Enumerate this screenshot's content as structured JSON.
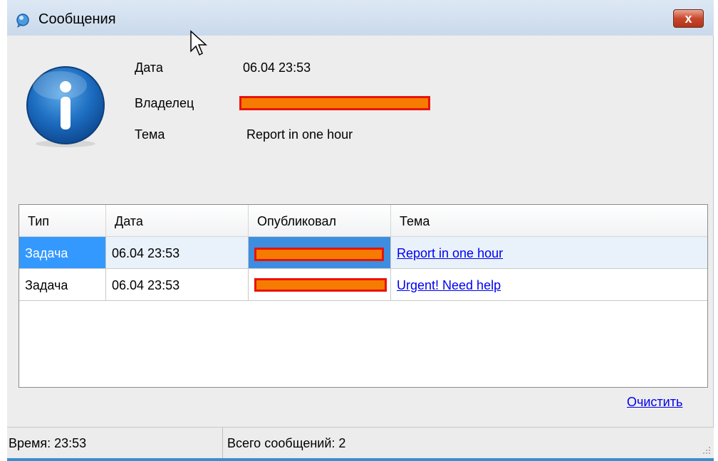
{
  "window": {
    "title": "Сообщения",
    "close_label": "x"
  },
  "details": {
    "date_label": "Дата",
    "date_value": "06.04 23:53",
    "owner_label": "Владелец",
    "subject_label": "Тема",
    "subject_value": "Report in one hour"
  },
  "table": {
    "headers": [
      "Тип",
      "Дата",
      "Опубликовал",
      "Тема"
    ],
    "rows": [
      {
        "type": "Задача",
        "date": "06.04 23:53",
        "subject": "Report in one hour"
      },
      {
        "type": "Задача",
        "date": "06.04 23:53",
        "subject": "Urgent! Need help "
      }
    ]
  },
  "actions": {
    "clear_label": "Очистить"
  },
  "status": {
    "time": "Время: 23:53",
    "count": "Всего сообщений: 2"
  },
  "colors": {
    "accent": "#3399ff",
    "redaction_fill": "#f57c00",
    "redaction_border": "#e8120c",
    "link": "#0000ee"
  }
}
